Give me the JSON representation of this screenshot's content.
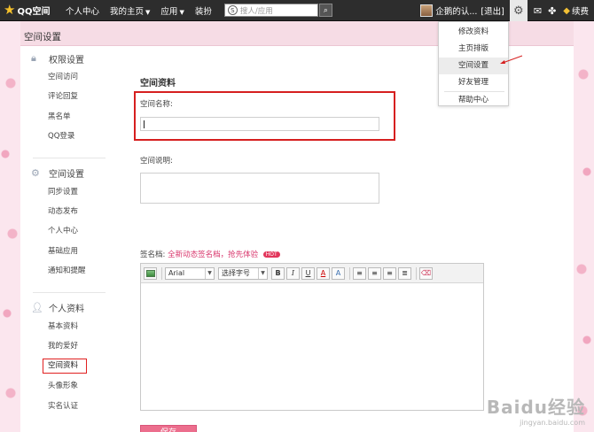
{
  "topbar": {
    "logo": "QQ空间",
    "nav": [
      {
        "label": "个人中心",
        "has_caret": false
      },
      {
        "label": "我的主页",
        "has_caret": true
      },
      {
        "label": "应用",
        "has_caret": true
      },
      {
        "label": "装扮",
        "has_caret": false
      }
    ],
    "search_placeholder": "搜人/应用",
    "username": "企鹅的认...",
    "logout": "[退出]",
    "vip_label": "续费"
  },
  "panel": {
    "title": "空间设置"
  },
  "sidebar": {
    "groups": [
      {
        "title": "权限设置",
        "icon": "lock-icon",
        "items": [
          "空间访问",
          "评论回复",
          "黑名单",
          "QQ登录"
        ]
      },
      {
        "title": "空间设置",
        "icon": "settings-icon",
        "items": [
          "同步设置",
          "动态发布",
          "个人中心",
          "基础应用",
          "通知和提醒"
        ]
      },
      {
        "title": "个人资料",
        "icon": "user-icon",
        "items": [
          "基本资料",
          "我的爱好",
          "空间资料",
          "头像形象",
          "实名认证"
        ],
        "active": "空间资料"
      }
    ]
  },
  "content": {
    "section_title": "空间资料",
    "name_label": "空间名称:",
    "name_value": "",
    "desc_label": "空间说明:",
    "sig_label": "签名档:",
    "sig_link": "全新动态签名档，抢先体验",
    "hot_badge": "HOT",
    "editor": {
      "font": "Arial",
      "size": "选择字号",
      "buttons": [
        "B",
        "I",
        "U",
        "A",
        "A"
      ]
    },
    "save_label": "保存"
  },
  "menu": {
    "items": [
      "修改资料",
      "主页排版",
      "空间设置",
      "好友管理"
    ],
    "highlighted": "空间设置",
    "footer": "帮助中心"
  },
  "watermark": {
    "brand": "Baidu经验",
    "url": "jingyan.baidu.com"
  },
  "colors": {
    "accent": "#ec6e8d",
    "highlight_box": "#d61f1f",
    "topbar": "#2d2d2d"
  }
}
